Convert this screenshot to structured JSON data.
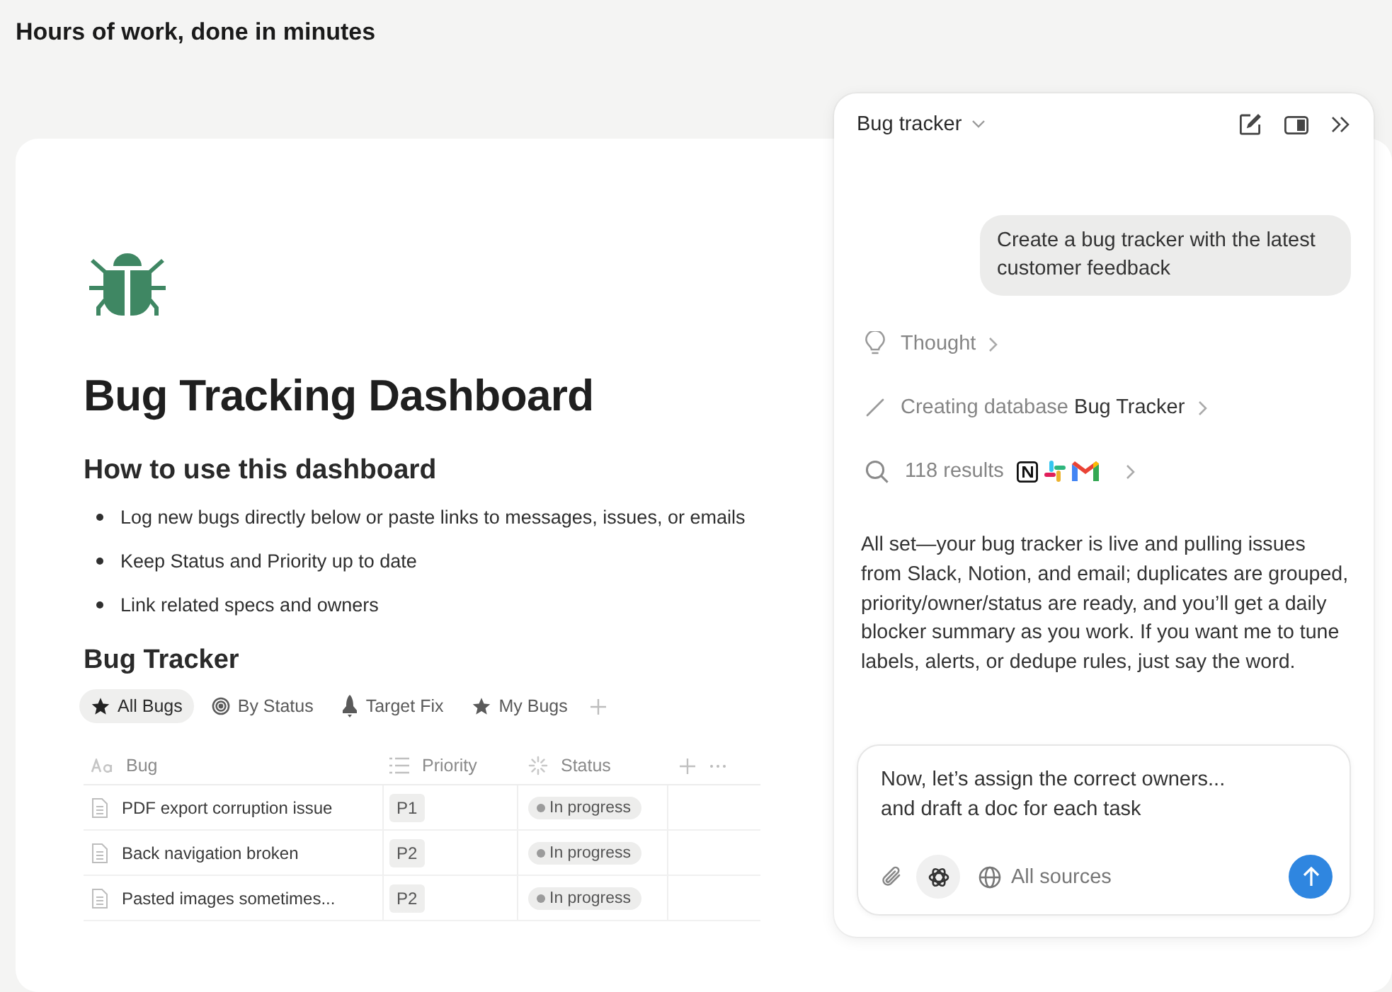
{
  "headline": "Hours of work, done in minutes",
  "page": {
    "title": "Bug Tracking Dashboard",
    "section_heading": "How to use this dashboard",
    "bullets": [
      "Log new bugs directly below or paste links to messages, issues, or emails",
      "Keep Status and Priority up to date",
      "Link related specs and owners"
    ],
    "database_title": "Bug Tracker",
    "views": [
      {
        "label": "All Bugs",
        "selected": true
      },
      {
        "label": "By Status",
        "selected": false
      },
      {
        "label": "Target Fix",
        "selected": false
      },
      {
        "label": "My Bugs",
        "selected": false
      }
    ],
    "table": {
      "columns": [
        {
          "label": "Bug"
        },
        {
          "label": "Priority"
        },
        {
          "label": "Status"
        }
      ],
      "rows": [
        {
          "bug": "PDF export corruption issue",
          "priority": "P1",
          "status": "In progress"
        },
        {
          "bug": "Back navigation broken",
          "priority": "P2",
          "status": "In progress"
        },
        {
          "bug": "Pasted images sometimes...",
          "priority": "P2",
          "status": "In progress"
        }
      ]
    }
  },
  "chat": {
    "title": "Bug tracker",
    "user_message": "Create a bug tracker with the latest customer feedback",
    "steps": [
      {
        "kind": "thought",
        "label": "Thought"
      },
      {
        "kind": "creating",
        "label": "Creating database **Bug Tracker**"
      },
      {
        "kind": "search",
        "label": "118 results"
      }
    ],
    "reply": "All set—your bug tracker is live and pulling issues from Slack, Notion, and email; duplicates are grouped, priority/owner/status are ready, and you’ll get a daily blocker summary as you work. If you want me to tune labels, alerts, or dedupe rules, just say the word.",
    "composer": {
      "value": "Now, let’s assign the correct owners...\nand draft a doc for each task",
      "sources_label": "All sources"
    }
  }
}
